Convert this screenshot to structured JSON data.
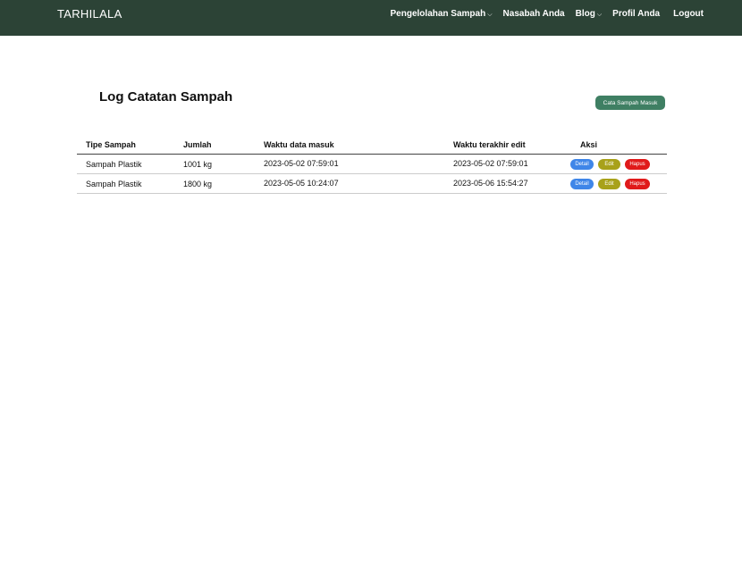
{
  "navbar": {
    "brand": "TARHILALA",
    "items": [
      {
        "label": "Pengelolahan Sampah",
        "dropdown": true
      },
      {
        "label": "Nasabah Anda",
        "dropdown": false
      },
      {
        "label": "Blog",
        "dropdown": true
      },
      {
        "label": "Profil Anda",
        "dropdown": false
      },
      {
        "label": "Logout",
        "dropdown": false
      }
    ],
    "caret": "⌵",
    "bg_color": "#2c4336"
  },
  "main": {
    "title": "Log Catatan Sampah",
    "add_button_label": "Cata Sampah Masuk"
  },
  "table": {
    "headers": [
      "Tipe Sampah",
      "Jumlah",
      "Waktu data masuk",
      "Waktu terakhir edit",
      "Aksi"
    ],
    "rows": [
      {
        "tipe": "Sampah Plastik",
        "jumlah": "1001 kg",
        "masuk": "2023-05-02 07:59:01",
        "edit": "2023-05-02 07:59:01"
      },
      {
        "tipe": "Sampah Plastik",
        "jumlah": "1800 kg",
        "masuk": "2023-05-05 10:24:07",
        "edit": "2023-05-06 15:54:27"
      }
    ],
    "actions": {
      "detail": "Detail",
      "edit": "Edit",
      "hapus": "Hapus"
    },
    "action_colors": {
      "detail": "#3f86e8",
      "edit": "#a8a11a",
      "hapus": "#e01a1a"
    }
  }
}
